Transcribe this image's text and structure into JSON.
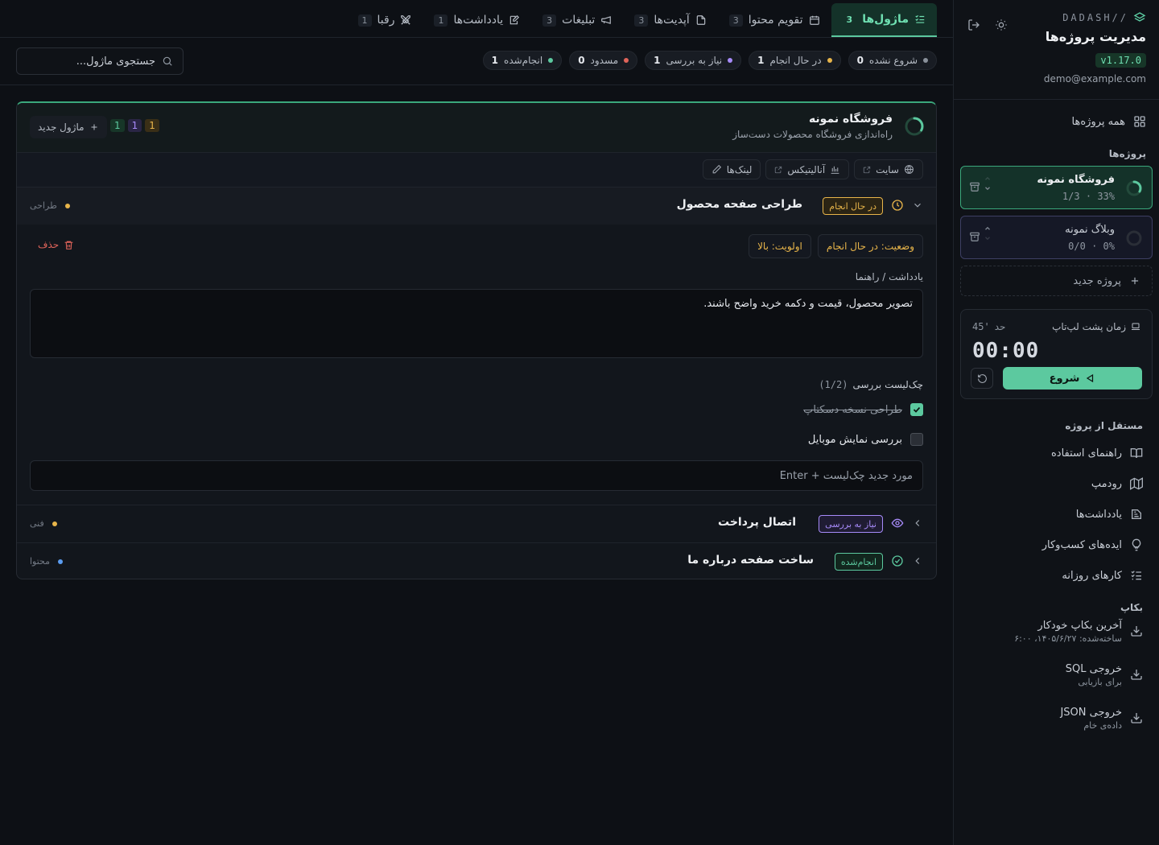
{
  "app": {
    "brand": "DADASH//",
    "title": "مدیریت پروژه‌ها",
    "version": "v1.17.0",
    "user_email": "demo@example.com"
  },
  "sidebar": {
    "all_projects": "همه پروژه‌ها",
    "projects_section": "پروژه‌ها",
    "projects": [
      {
        "name": "فروشگاه نمونه",
        "percent": "33%",
        "count": "1/3",
        "progress": 0.33,
        "active": true
      },
      {
        "name": "وبلاگ نمونه",
        "percent": "0%",
        "count": "0/0",
        "progress": 0,
        "active": false
      }
    ],
    "meta_sep": "·",
    "new_project": "پروژه جدید",
    "timer": {
      "title": "زمان پشت لپ‌تاپ",
      "limit_label": "حد",
      "limit_value": "45'",
      "value": "00:00",
      "start_label": "شروع"
    },
    "independent_section": "مستقل از پروژه",
    "independent_items": [
      {
        "label": "راهنمای استفاده",
        "icon": "book-icon"
      },
      {
        "label": "رودمپ",
        "icon": "map-icon"
      },
      {
        "label": "یادداشت‌ها",
        "icon": "note-icon"
      },
      {
        "label": "ایده‌های کسب‌وکار",
        "icon": "lightbulb-icon"
      },
      {
        "label": "کارهای روزانه",
        "icon": "checklist-icon"
      }
    ],
    "backup_section": "بکاپ",
    "backup_items": [
      {
        "title": "آخرین بکاپ خودکار",
        "sub": "ساخته‌شده: ۱۴۰۵/۶/۲۷، ۶:۰۰"
      },
      {
        "title": "خروجی SQL",
        "sub": "برای بازیابی"
      },
      {
        "title": "خروجی JSON",
        "sub": "داده‌ی خام"
      }
    ]
  },
  "tabs": [
    {
      "label": "ماژول‌ها",
      "count": "3",
      "icon": "list-check-icon",
      "active": true
    },
    {
      "label": "تقویم محتوا",
      "count": "3",
      "icon": "calendar-icon",
      "active": false
    },
    {
      "label": "آپدیت‌ها",
      "count": "3",
      "icon": "file-icon",
      "active": false
    },
    {
      "label": "تبلیغات",
      "count": "3",
      "icon": "megaphone-icon",
      "active": false
    },
    {
      "label": "یادداشت‌ها",
      "count": "1",
      "icon": "edit-note-icon",
      "active": false
    },
    {
      "label": "رقبا",
      "count": "1",
      "icon": "swords-icon",
      "active": false
    }
  ],
  "status_chips": [
    {
      "label": "شروع نشده",
      "count": "0",
      "color": "#8a919b"
    },
    {
      "label": "در حال انجام",
      "count": "1",
      "color": "#e8b54a"
    },
    {
      "label": "نیاز به بررسی",
      "count": "1",
      "color": "#a78bfa"
    },
    {
      "label": "مسدود",
      "count": "0",
      "color": "#e0645a"
    },
    {
      "label": "انجام‌شده",
      "count": "1",
      "color": "#5cc99f"
    }
  ],
  "search": {
    "placeholder": "جستجوی ماژول..."
  },
  "project": {
    "title": "فروشگاه نمونه",
    "description": "راه‌اندازی فروشگاه محصولات دست‌ساز",
    "progress": 0.33,
    "counts": [
      {
        "value": "1",
        "color": "#e8b54a",
        "bg": "#3a2f17"
      },
      {
        "value": "1",
        "color": "#a78bfa",
        "bg": "#2a2545"
      },
      {
        "value": "1",
        "color": "#5cc99f",
        "bg": "#173628"
      }
    ],
    "new_module": "ماژول جدید",
    "links": [
      {
        "label": "سایت",
        "icon": "globe-icon"
      },
      {
        "label": "آنالیتیکس",
        "icon": "bar-chart-icon"
      },
      {
        "label": "لینک‌ها",
        "icon": "pencil-icon"
      }
    ],
    "modules": [
      {
        "title": "طراحی صفحه محصول",
        "badge": "در حال انجام",
        "badge_color": "#e8b54a",
        "badge_bg": "#2b2414",
        "status_icon": "clock-icon",
        "category": "طراحی",
        "dot_color": "#e8b54a",
        "open": true,
        "status_prop": "وضعیت: در حال انجام",
        "priority_prop": "اولویت: بالا",
        "delete_label": "حذف",
        "note_label": "یادداشت / راهنما",
        "note_text": "تصویر محصول، قیمت و دکمه خرید واضح باشند.",
        "checklist_label": "چک‌لیست بررسی",
        "checklist_progress": "(1/2)",
        "checklist": [
          {
            "text": "طراحی نسخه دسکتاپ",
            "done": true
          },
          {
            "text": "بررسی نمایش موبایل",
            "done": false
          }
        ],
        "new_check_placeholder": "مورد جدید چک‌لیست + Enter"
      },
      {
        "title": "اتصال پرداخت",
        "badge": "نیاز به بررسی",
        "badge_color": "#a78bfa",
        "badge_bg": "#1f1c33",
        "status_icon": "eye-icon",
        "category": "فنی",
        "dot_color": "#e8b54a",
        "open": false
      },
      {
        "title": "ساخت صفحه درباره ما",
        "badge": "انجام‌شده",
        "badge_color": "#5cc99f",
        "badge_bg": "#12261e",
        "status_icon": "check-circle-icon",
        "category": "محتوا",
        "dot_color": "#5b9cf0",
        "open": false
      }
    ]
  }
}
